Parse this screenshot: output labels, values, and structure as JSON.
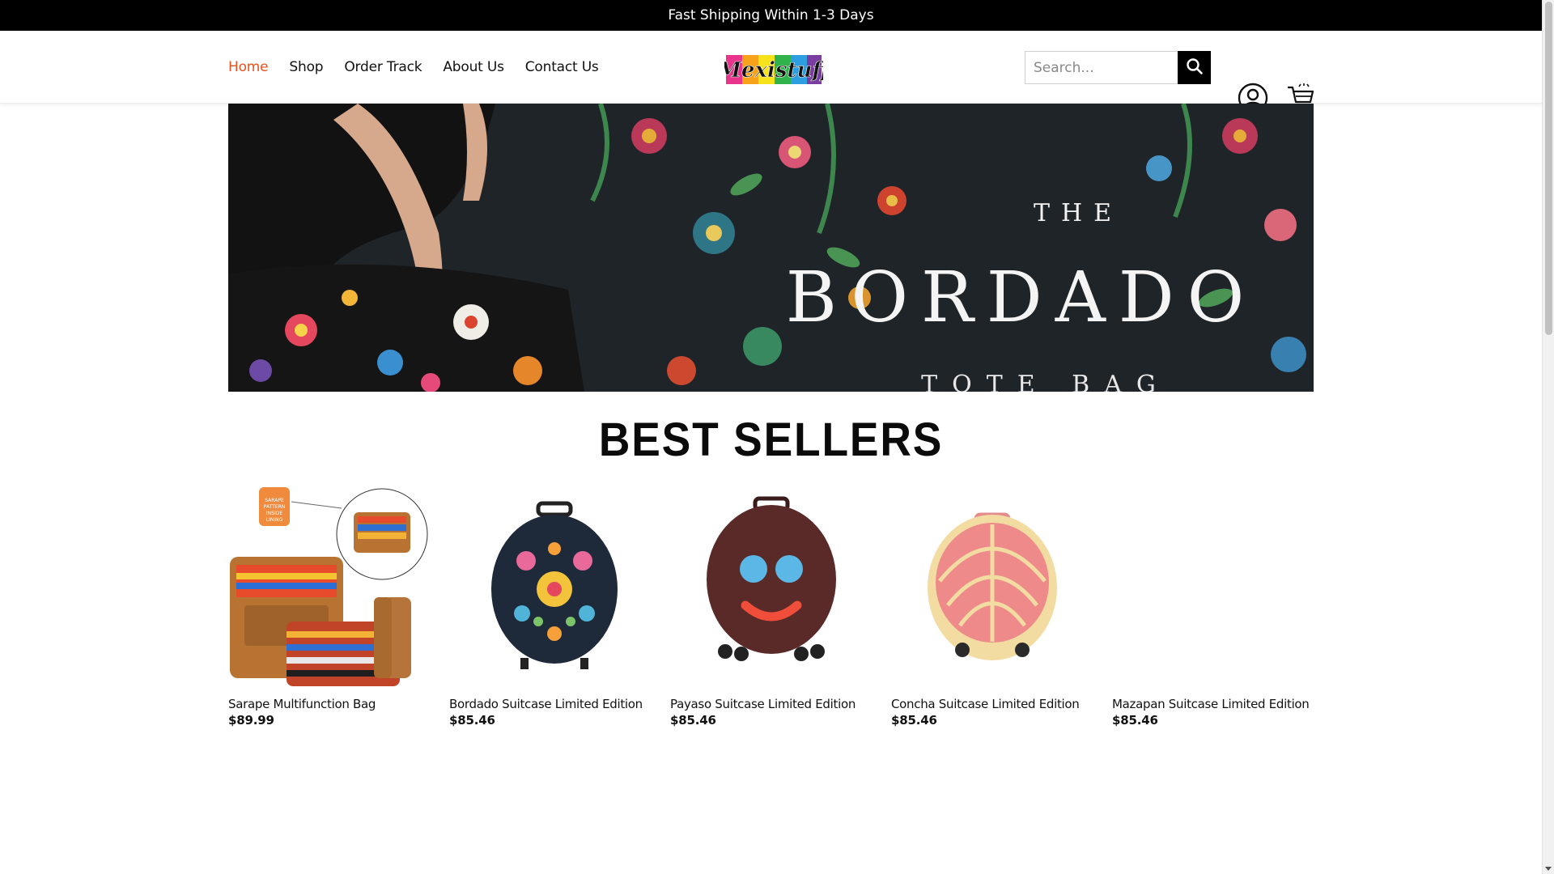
{
  "announcement": "Fast Shipping Within 1-3 Days",
  "nav": {
    "items": [
      {
        "label": "Home",
        "active": true
      },
      {
        "label": "Shop"
      },
      {
        "label": "Order Track"
      },
      {
        "label": "About Us"
      },
      {
        "label": "Contact Us"
      }
    ]
  },
  "logo": {
    "text": "Mexistuff"
  },
  "search": {
    "placeholder": "Search..."
  },
  "hero": {
    "line1": "THE",
    "title": "BORDADO",
    "line3": "TOTE BAG"
  },
  "best_sellers": {
    "title": "BEST SELLERS",
    "badge_text": "SARAPE PATTERN INSIDE LINING",
    "products": [
      {
        "name": "Sarape Multifunction Bag",
        "price": "$89.99"
      },
      {
        "name": "Bordado Suitcase Limited Edition",
        "price": "$85.46"
      },
      {
        "name": "Payaso Suitcase Limited Edition",
        "price": "$85.46"
      },
      {
        "name": "Concha Suitcase Limited Edition",
        "price": "$85.46"
      },
      {
        "name": "Mazapan Suitcase Limited Edition",
        "price": "$85.46"
      }
    ]
  },
  "colors": {
    "accent": "#e8501c",
    "announcement_bg": "#000000"
  }
}
